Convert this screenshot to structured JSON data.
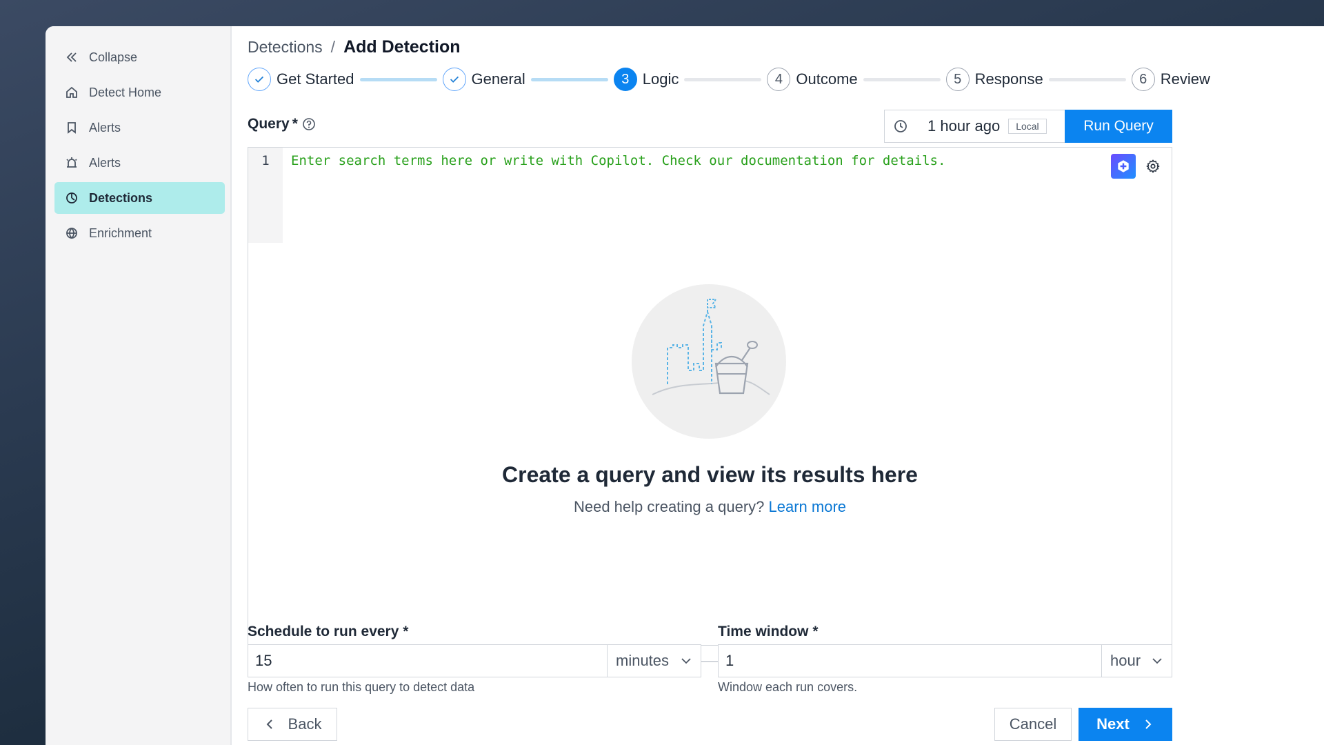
{
  "sidebar": {
    "items": [
      {
        "label": "Collapse",
        "icon": "double-chevron-left-icon"
      },
      {
        "label": "Detect Home",
        "icon": "home-icon"
      },
      {
        "label": "Alerts",
        "icon": "bookmark-icon"
      },
      {
        "label": "Alerts",
        "icon": "alarm-icon"
      },
      {
        "label": "Detections",
        "icon": "detections-icon",
        "active": true
      },
      {
        "label": "Enrichment",
        "icon": "globe-icon"
      }
    ]
  },
  "breadcrumb": {
    "parent": "Detections",
    "separator": "/",
    "current": "Add Detection"
  },
  "stepper": {
    "steps": [
      {
        "number": "1",
        "label": "Get Started",
        "state": "done"
      },
      {
        "number": "2",
        "label": "General",
        "state": "done"
      },
      {
        "number": "3",
        "label": "Logic",
        "state": "current"
      },
      {
        "number": "4",
        "label": "Outcome",
        "state": "pending"
      },
      {
        "number": "5",
        "label": "Response",
        "state": "pending"
      },
      {
        "number": "6",
        "label": "Review",
        "state": "pending"
      }
    ]
  },
  "query": {
    "label": "Query",
    "required_mark": "*",
    "time_range": "1 hour ago",
    "timezone_badge": "Local",
    "run_button": "Run Query",
    "line_number": "1",
    "placeholder": "Enter search terms here or write with Copilot. Check our documentation for details."
  },
  "results": {
    "empty_title": "Create a query and view its results here",
    "help_text": "Need help creating a query?",
    "help_link": "Learn more"
  },
  "schedule": {
    "label": "Schedule to run every",
    "required_mark": "*",
    "value": "15",
    "unit": "minutes",
    "hint": "How often to run this query to detect data"
  },
  "time_window": {
    "label": "Time window",
    "required_mark": "*",
    "value": "1",
    "unit": "hour",
    "hint": "Window each run covers."
  },
  "footer": {
    "back": "Back",
    "cancel": "Cancel",
    "next": "Next"
  },
  "colors": {
    "primary": "#0b84f0",
    "active_nav": "#aeeceb",
    "code_text": "#28a01b",
    "link": "#0b78d4"
  }
}
